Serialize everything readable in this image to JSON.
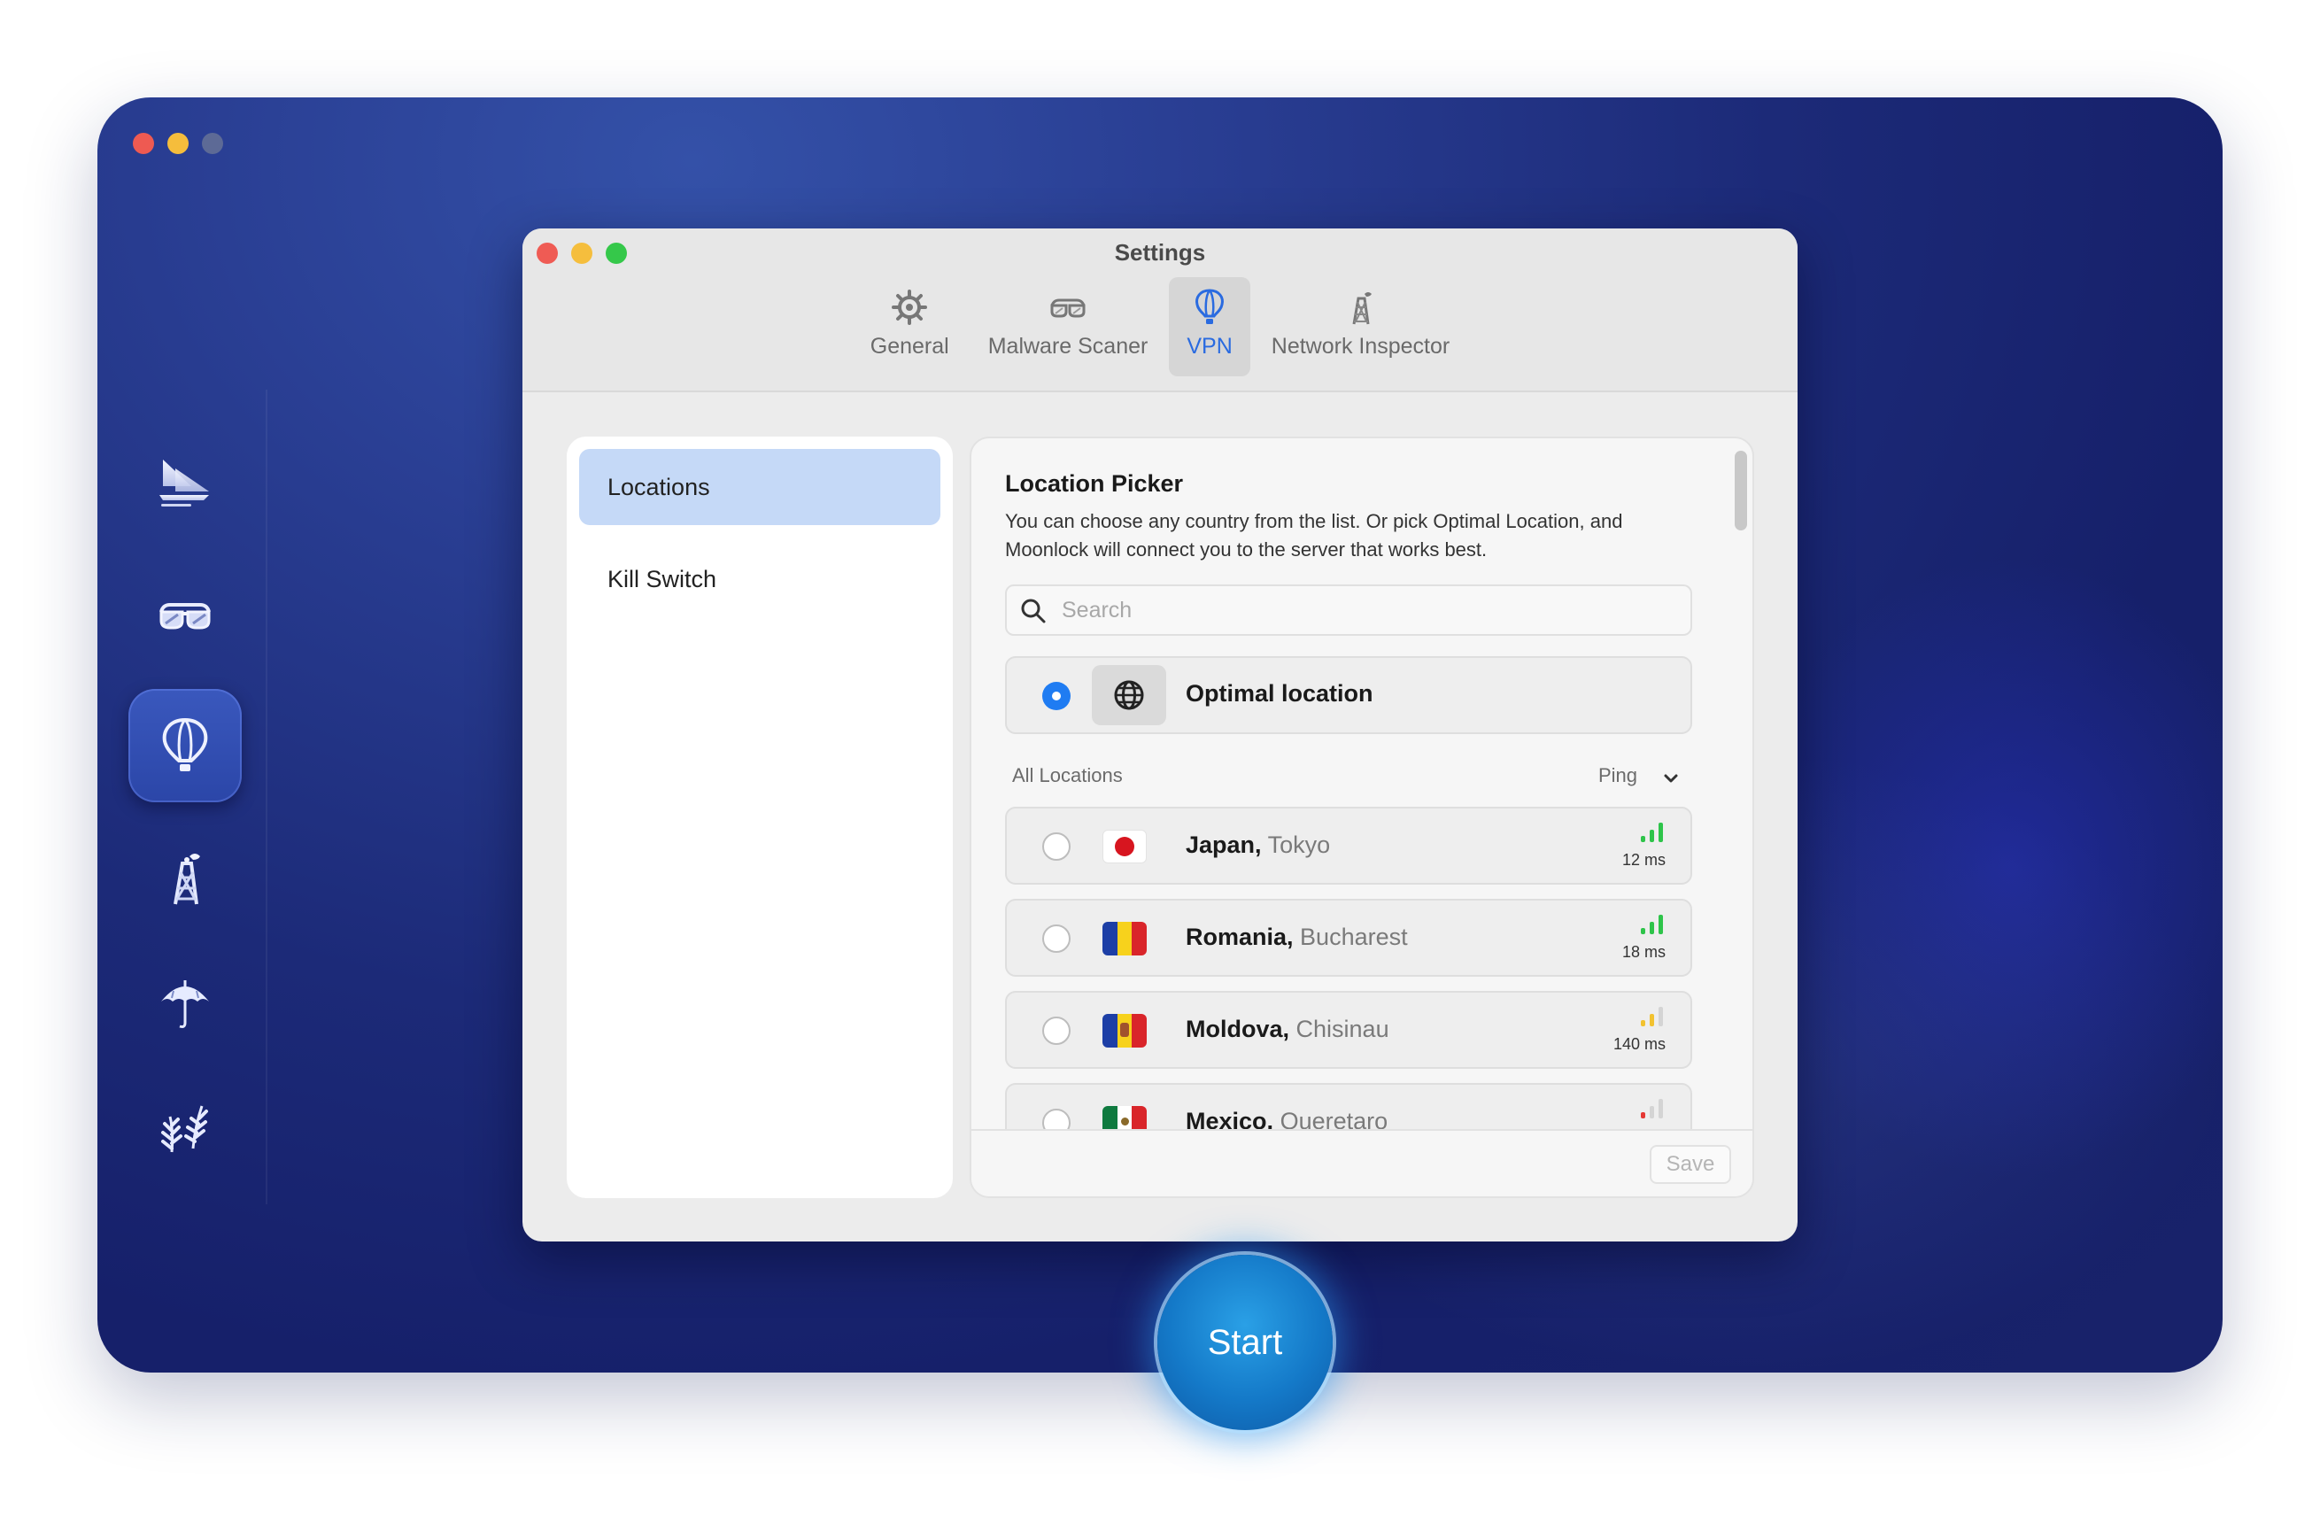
{
  "settings": {
    "title": "Settings",
    "tabs": [
      {
        "label": "General",
        "icon": "gear-icon"
      },
      {
        "label": "Malware Scaner",
        "icon": "glasses-icon"
      },
      {
        "label": "VPN",
        "icon": "balloon-icon",
        "active": true
      },
      {
        "label": "Network Inspector",
        "icon": "tower-icon"
      }
    ]
  },
  "sidebar": {
    "items": [
      {
        "name": "ship-icon"
      },
      {
        "name": "glasses-icon"
      },
      {
        "name": "balloon-icon",
        "active": true
      },
      {
        "name": "tower-icon"
      },
      {
        "name": "umbrella-icon"
      },
      {
        "name": "plant-icon"
      }
    ]
  },
  "left_panel": {
    "items": [
      {
        "label": "Locations",
        "active": true
      },
      {
        "label": "Kill Switch"
      }
    ]
  },
  "location_picker": {
    "title": "Location Picker",
    "description": "You can choose any country from the list. Or pick Optimal Location, and Moonlock will connect you to the server that works best.",
    "search_placeholder": "Search",
    "optimal_label": "Optimal location",
    "section_label": "All Locations",
    "sort_label": "Ping",
    "locations": [
      {
        "country": "Japan,",
        "city": "Tokyo",
        "ping": "12 ms",
        "signal": 3,
        "signal_color": "#2ec44a"
      },
      {
        "country": "Romania,",
        "city": "Bucharest",
        "ping": "18 ms",
        "signal": 3,
        "signal_color": "#2ec44a"
      },
      {
        "country": "Moldova,",
        "city": "Chisinau",
        "ping": "140 ms",
        "signal": 2,
        "signal_color": "#f2c230"
      },
      {
        "country": "Mexico,",
        "city": "Queretaro",
        "ping": "",
        "signal": 1,
        "signal_color": "#e53935"
      }
    ],
    "save_label": "Save"
  },
  "start_button": "Start",
  "colors": {
    "accent": "#1f7cf2",
    "tab_active": "#2a6be0",
    "selection": "#c5d9f7"
  }
}
